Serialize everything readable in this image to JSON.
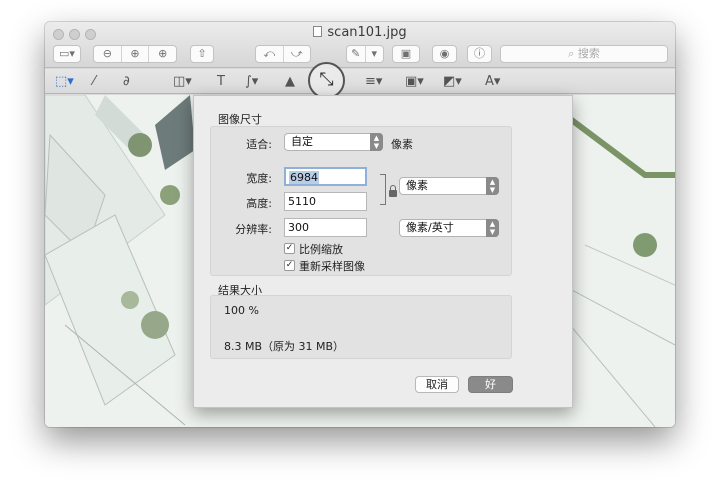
{
  "window": {
    "title": "scan101.jpg"
  },
  "toolbar": {
    "search_placeholder": "搜索"
  },
  "dialog": {
    "section_image_size": "图像尺寸",
    "fit_label": "适合:",
    "fit_value": "自定",
    "fit_unit": "像素",
    "width_label": "宽度:",
    "width_value": "6984",
    "height_label": "高度:",
    "height_value": "5110",
    "dimension_unit": "像素",
    "resolution_label": "分辨率:",
    "resolution_value": "300",
    "resolution_unit": "像素/英寸",
    "scale_proportionally": "比例缩放",
    "resample_image": "重新采样图像",
    "section_result": "结果大小",
    "result_percent": "100 %",
    "result_size": "8.3 MB（原为 31 MB）",
    "cancel_label": "取消",
    "ok_label": "好"
  },
  "icons": [
    "close-icon",
    "minimize-icon",
    "zoom-icon",
    "document-icon",
    "sidebar-icon",
    "zoom-out-icon",
    "zoom-in-icon",
    "share-icon",
    "rotate-left-icon",
    "rotate-right-icon",
    "pen-icon",
    "toolbox-icon",
    "stamp-icon",
    "info-icon",
    "search-icon",
    "rect-select-icon",
    "magic-wand-icon",
    "sketch-icon",
    "shapes-icon",
    "text-icon",
    "signature-icon",
    "adjust-color-icon",
    "resize-icon",
    "line-style-icon",
    "border-color-icon",
    "fill-color-icon",
    "font-icon",
    "lock-icon",
    "checkmark-icon",
    "popup-arrows-icon"
  ],
  "colors": {
    "selection": "#b9cde6",
    "default_button": "#8a8a8a"
  }
}
